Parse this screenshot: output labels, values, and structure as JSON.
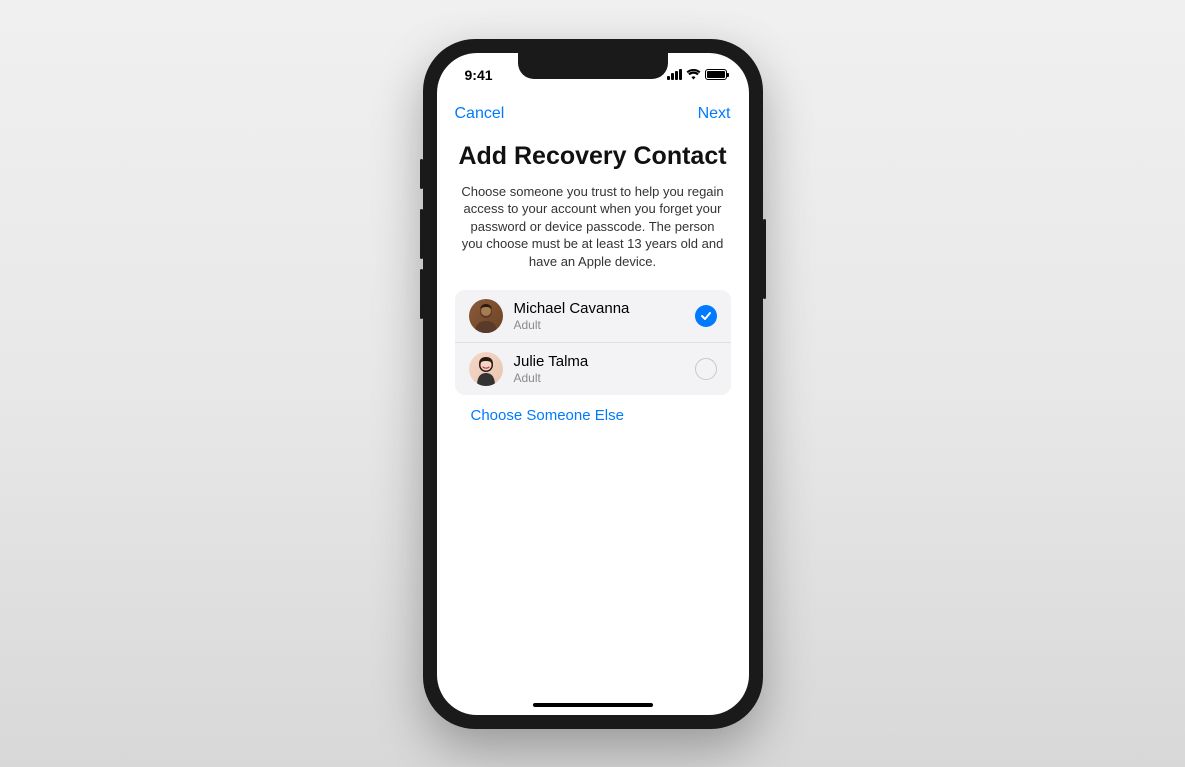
{
  "statusbar": {
    "time": "9:41"
  },
  "nav": {
    "cancel": "Cancel",
    "next": "Next"
  },
  "page": {
    "title": "Add Recovery Contact",
    "description": "Choose someone you trust to help you regain access to your account when you forget your password or device passcode. The person you choose must be at least 13 years old and have an Apple device."
  },
  "contacts": [
    {
      "name": "Michael Cavanna",
      "role": "Adult",
      "selected": true
    },
    {
      "name": "Julie Talma",
      "role": "Adult",
      "selected": false
    }
  ],
  "actions": {
    "chooseElse": "Choose Someone Else"
  }
}
